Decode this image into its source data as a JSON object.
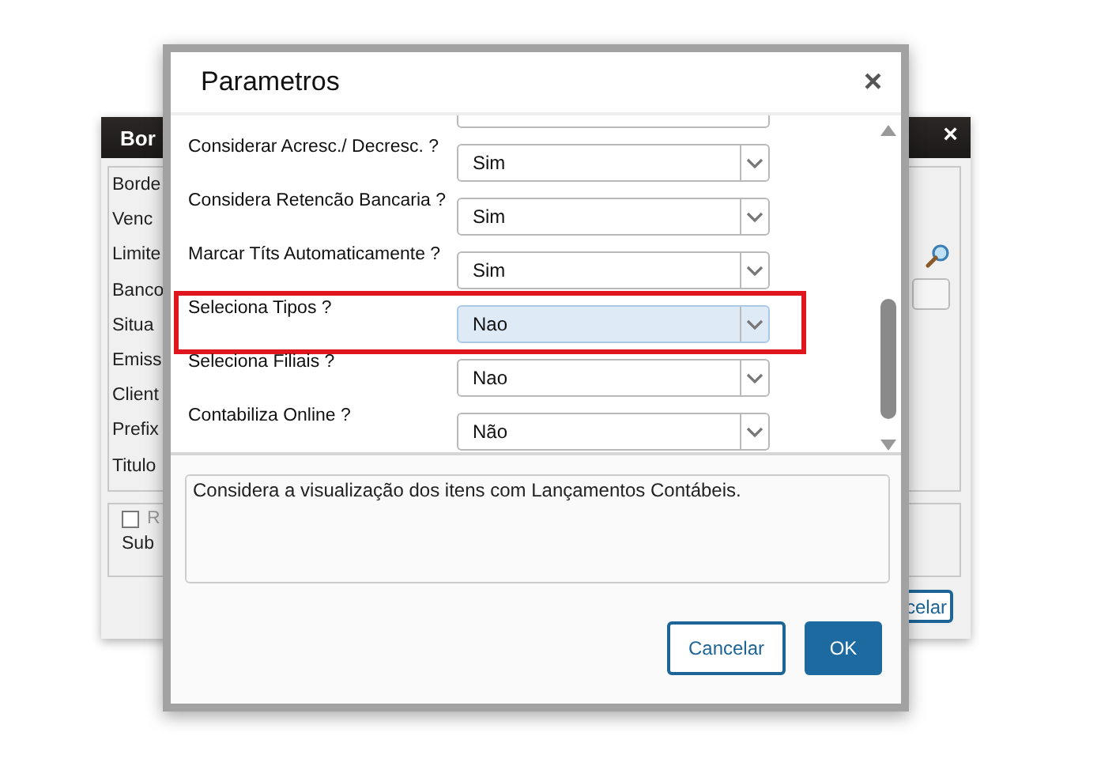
{
  "background_window": {
    "title": "Bor",
    "close": "×",
    "labels": [
      "Borde",
      "Venc",
      "Limite",
      "Banco",
      "Situa",
      "Emiss",
      "Client",
      "Prefix",
      "Titulo"
    ],
    "checkbox": {
      "label": "R",
      "checked": false
    },
    "sub_label": "Sub",
    "button": "celar"
  },
  "dialog": {
    "title": "Parametros",
    "close": "×",
    "parameters": [
      {
        "label": "Considerar Acresc./ Decresc. ?",
        "value": "Sim",
        "focused": false,
        "highlighted": false
      },
      {
        "label": "Considera Retencão Bancaria ?",
        "value": "Sim",
        "focused": false,
        "highlighted": false
      },
      {
        "label": "Marcar Títs Automaticamente ?",
        "value": "Sim",
        "focused": false,
        "highlighted": false
      },
      {
        "label": "Seleciona Tipos ?",
        "value": "Nao",
        "focused": true,
        "highlighted": true
      },
      {
        "label": "Seleciona Filiais ?",
        "value": "Nao",
        "focused": false,
        "highlighted": false
      },
      {
        "label": "Contabiliza Online ?",
        "value": "Não",
        "focused": false,
        "highlighted": false
      }
    ],
    "description": "Considera a visualização dos itens com Lançamentos Contábeis.",
    "buttons": [
      {
        "label": "Cancelar",
        "kind": "secondary"
      },
      {
        "label": "OK",
        "kind": "primary"
      }
    ]
  }
}
